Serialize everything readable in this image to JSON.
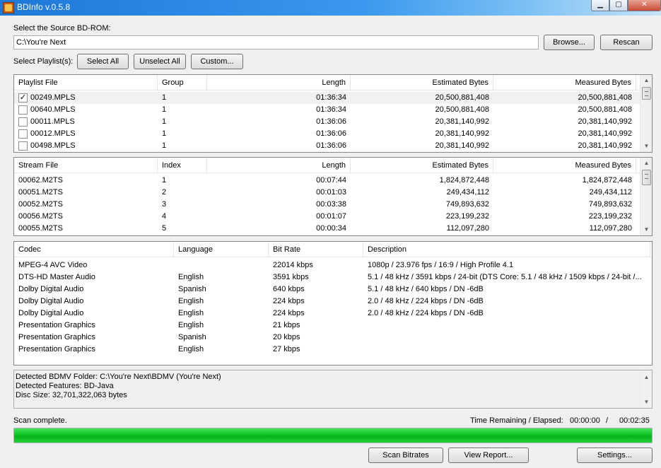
{
  "window": {
    "title": "BDInfo v.0.5.8",
    "min_glyph": "▁",
    "max_glyph": "▢",
    "close_glyph": "✕"
  },
  "source": {
    "label": "Select the Source BD-ROM:",
    "path_value": "C:\\You're Next",
    "browse_label": "Browse...",
    "rescan_label": "Rescan"
  },
  "playlist_controls": {
    "label": "Select Playlist(s):",
    "select_all": "Select All",
    "unselect_all": "Unselect All",
    "custom": "Custom..."
  },
  "playlists": {
    "headers": [
      "Playlist File",
      "Group",
      "Length",
      "Estimated Bytes",
      "Measured Bytes"
    ],
    "rows": [
      {
        "checked": true,
        "file": "00249.MPLS",
        "group": "1",
        "length": "01:36:34",
        "est": "20,500,881,408",
        "meas": "20,500,881,408"
      },
      {
        "checked": false,
        "file": "00640.MPLS",
        "group": "1",
        "length": "01:36:34",
        "est": "20,500,881,408",
        "meas": "20,500,881,408"
      },
      {
        "checked": false,
        "file": "00011.MPLS",
        "group": "1",
        "length": "01:36:06",
        "est": "20,381,140,992",
        "meas": "20,381,140,992"
      },
      {
        "checked": false,
        "file": "00012.MPLS",
        "group": "1",
        "length": "01:36:06",
        "est": "20,381,140,992",
        "meas": "20,381,140,992"
      },
      {
        "checked": false,
        "file": "00498.MPLS",
        "group": "1",
        "length": "01:36:06",
        "est": "20,381,140,992",
        "meas": "20,381,140,992"
      }
    ],
    "check_glyph": "✓"
  },
  "streams": {
    "headers": [
      "Stream File",
      "Index",
      "Length",
      "Estimated Bytes",
      "Measured Bytes"
    ],
    "rows": [
      {
        "file": "00062.M2TS",
        "index": "1",
        "length": "00:07:44",
        "est": "1,824,872,448",
        "meas": "1,824,872,448"
      },
      {
        "file": "00051.M2TS",
        "index": "2",
        "length": "00:01:03",
        "est": "249,434,112",
        "meas": "249,434,112"
      },
      {
        "file": "00052.M2TS",
        "index": "3",
        "length": "00:03:38",
        "est": "749,893,632",
        "meas": "749,893,632"
      },
      {
        "file": "00056.M2TS",
        "index": "4",
        "length": "00:01:07",
        "est": "223,199,232",
        "meas": "223,199,232"
      },
      {
        "file": "00055.M2TS",
        "index": "5",
        "length": "00:00:34",
        "est": "112,097,280",
        "meas": "112,097,280"
      }
    ]
  },
  "codecs": {
    "headers": [
      "Codec",
      "Language",
      "Bit Rate",
      "Description"
    ],
    "rows": [
      {
        "codec": "MPEG-4 AVC Video",
        "lang": "",
        "rate": "22014 kbps",
        "desc": "1080p / 23.976 fps / 16:9 / High Profile 4.1"
      },
      {
        "codec": "DTS-HD Master Audio",
        "lang": "English",
        "rate": "3591 kbps",
        "desc": "5.1 / 48 kHz / 3591 kbps / 24-bit (DTS Core: 5.1 / 48 kHz / 1509 kbps / 24-bit /..."
      },
      {
        "codec": "Dolby Digital Audio",
        "lang": "Spanish",
        "rate": "640 kbps",
        "desc": "5.1 / 48 kHz / 640 kbps / DN -6dB"
      },
      {
        "codec": "Dolby Digital Audio",
        "lang": "English",
        "rate": "224 kbps",
        "desc": "2.0 / 48 kHz / 224 kbps / DN -6dB"
      },
      {
        "codec": "Dolby Digital Audio",
        "lang": "English",
        "rate": "224 kbps",
        "desc": "2.0 / 48 kHz / 224 kbps / DN -6dB"
      },
      {
        "codec": "Presentation Graphics",
        "lang": "English",
        "rate": "21 kbps",
        "desc": ""
      },
      {
        "codec": "Presentation Graphics",
        "lang": "Spanish",
        "rate": "20 kbps",
        "desc": ""
      },
      {
        "codec": "Presentation Graphics",
        "lang": "English",
        "rate": "27 kbps",
        "desc": ""
      }
    ]
  },
  "report": {
    "lines": [
      "Detected BDMV Folder: C:\\You're Next\\BDMV (You're Next)",
      "Detected Features: BD-Java",
      "Disc Size: 32,701,322,063 bytes"
    ]
  },
  "status": {
    "text": "Scan complete.",
    "time_label": "Time Remaining / Elapsed:",
    "remaining": "00:00:00",
    "separator": "/",
    "elapsed": "00:02:35"
  },
  "progress": {
    "fraction": 1.0
  },
  "actions": {
    "scan_bitrates": "Scan Bitrates",
    "view_report": "View Report...",
    "settings": "Settings..."
  },
  "scroll": {
    "up": "▲",
    "down": "▼"
  },
  "colors": {
    "progress_green": "#0fc423",
    "title_blue": "#1e78d8"
  }
}
